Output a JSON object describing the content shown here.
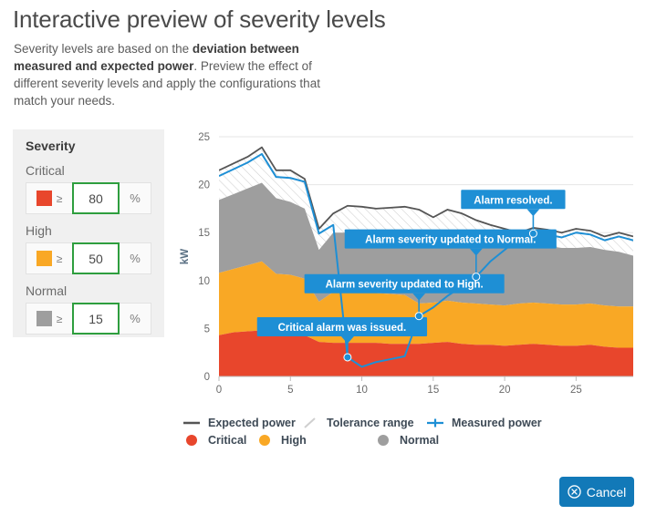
{
  "header": {
    "title": "Interactive preview of severity levels",
    "desc_part1": "Severity levels are based on the ",
    "desc_bold": "deviation between measured and expected power",
    "desc_part2": ". Preview the effect of different severity levels and apply the configurations that match your needs."
  },
  "severity_panel": {
    "title": "Severity",
    "ge_symbol": "≥",
    "unit": "%",
    "rows": [
      {
        "label": "Critical",
        "color": "#e8462c",
        "value": "80"
      },
      {
        "label": "High",
        "color": "#f9a825",
        "value": "50"
      },
      {
        "label": "Normal",
        "color": "#9e9e9e",
        "value": "15"
      }
    ]
  },
  "footer": {
    "cancel_label": "Cancel",
    "cancel_icon": "circle-x-icon"
  },
  "chart_data": {
    "type": "area",
    "title": "",
    "xlabel": "",
    "ylabel": "kW",
    "xlim": [
      0,
      29
    ],
    "ylim": [
      0,
      25
    ],
    "xticks": [
      0,
      5,
      10,
      15,
      20,
      25
    ],
    "yticks": [
      0,
      5,
      10,
      15,
      20,
      25
    ],
    "grid": true,
    "legend_position": "bottom",
    "colors": {
      "critical": "#e8462c",
      "high": "#f9a825",
      "normal": "#9e9e9e",
      "expected": "#555555",
      "measured": "#1e8fd5",
      "tolerance": "#cccccc"
    },
    "x": [
      0,
      1,
      2,
      3,
      4,
      5,
      6,
      7,
      8,
      9,
      10,
      11,
      12,
      13,
      14,
      15,
      16,
      17,
      18,
      19,
      20,
      21,
      22,
      23,
      24,
      25,
      26,
      27,
      28,
      29
    ],
    "series": [
      {
        "name": "Critical",
        "type": "area",
        "values": [
          4.3,
          4.6,
          4.7,
          4.8,
          4.5,
          4.4,
          4.3,
          3.6,
          3.5,
          3.5,
          3.5,
          3.5,
          3.4,
          3.4,
          3.4,
          3.5,
          3.6,
          3.4,
          3.3,
          3.3,
          3.2,
          3.3,
          3.4,
          3.3,
          3.2,
          3.2,
          3.3,
          3.1,
          3.0,
          3.0
        ]
      },
      {
        "name": "High",
        "type": "area",
        "values": [
          10.8,
          11.2,
          11.6,
          12.0,
          10.7,
          10.6,
          10.2,
          7.8,
          8.8,
          8.8,
          8.8,
          8.7,
          8.6,
          8.5,
          7.6,
          7.7,
          7.9,
          7.7,
          7.6,
          7.5,
          7.4,
          7.6,
          7.7,
          7.6,
          7.5,
          7.5,
          7.6,
          7.4,
          7.3,
          7.3
        ]
      },
      {
        "name": "Normal",
        "type": "area",
        "values": [
          18.4,
          19.0,
          19.6,
          20.2,
          18.6,
          18.2,
          17.5,
          13.2,
          15.0,
          15.0,
          15.0,
          15.0,
          14.9,
          14.8,
          13.9,
          14.3,
          14.6,
          14.2,
          13.9,
          13.6,
          13.4,
          13.6,
          13.7,
          13.6,
          13.4,
          13.4,
          13.5,
          13.2,
          13.0,
          12.6
        ]
      },
      {
        "name": "Expected power",
        "type": "line",
        "values": [
          21.5,
          22.2,
          22.9,
          23.9,
          21.5,
          21.5,
          20.6,
          15.4,
          17.0,
          17.8,
          17.7,
          17.5,
          17.6,
          17.7,
          17.4,
          16.6,
          17.4,
          17.0,
          16.3,
          15.8,
          15.4,
          15.0,
          15.5,
          15.3,
          15.0,
          15.4,
          15.2,
          14.6,
          15.0,
          14.6
        ]
      },
      {
        "name": "Measured power",
        "type": "line",
        "values": [
          20.9,
          21.6,
          22.3,
          23.2,
          20.8,
          20.7,
          20.3,
          14.9,
          15.8,
          2.0,
          1.0,
          1.5,
          1.8,
          2.1,
          6.3,
          7.2,
          8.4,
          9.4,
          10.4,
          12.0,
          13.2,
          14.4,
          14.9,
          14.8,
          14.5,
          15.0,
          14.8,
          14.2,
          14.6,
          14.2
        ]
      }
    ],
    "annotations": [
      {
        "text": "Critical alarm was issued.",
        "x": 9,
        "y": 2.0
      },
      {
        "text": "Alarm severity updated to High.",
        "x": 14,
        "y": 6.3
      },
      {
        "text": "Alarm severity updated to Normal.",
        "x": 18,
        "y": 10.4
      },
      {
        "text": "Alarm resolved.",
        "x": 22,
        "y": 14.9
      }
    ],
    "legend": [
      {
        "label": "Expected power",
        "marker": "line",
        "color": "#555555"
      },
      {
        "label": "Tolerance range",
        "marker": "hatch",
        "color": "#cccccc"
      },
      {
        "label": "Measured power",
        "marker": "cross",
        "color": "#1e8fd5"
      },
      {
        "label": "Critical",
        "marker": "dot",
        "color": "#e8462c"
      },
      {
        "label": "High",
        "marker": "dot",
        "color": "#f9a825"
      },
      {
        "label": "Normal",
        "marker": "dot",
        "color": "#9e9e9e"
      }
    ]
  }
}
